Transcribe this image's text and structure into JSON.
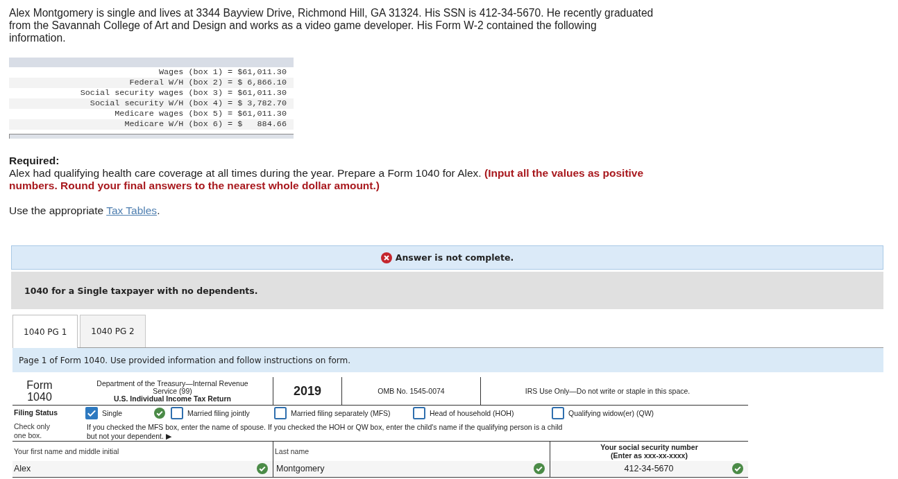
{
  "intro": "Alex Montgomery is single and lives at 3344 Bayview Drive, Richmond Hill, GA 31324. His SSN is 412-34-5670. He recently graduated from the Savannah College of Art and Design and works as a video game developer. His Form W-2 contained the following information.",
  "w2_table": {
    "rows": [
      "Wages (box 1) = $61,011.30",
      "Federal W/H (box 2) = $ 6,866.10",
      "Social security wages (box 3) = $61,011.30",
      "Social security W/H (box 4) = $ 3,782.70",
      "Medicare wages (box 5) = $61,011.30",
      "Medicare W/H (box 6) = $   884.66"
    ]
  },
  "required": {
    "heading": "Required:",
    "text": "Alex had qualifying health care coverage at all times during the year. Prepare a Form 1040 for Alex. **(Input all the values as positive numbers. Round your final answers to the nearest whole dollar amount.)**",
    "use_prefix": "Use the appropriate",
    "link": "Tax Tables",
    "use_suffix": "."
  },
  "answer_status": {
    "text": "Answer is not complete.",
    "complete": false
  },
  "problem_title": "1040 for a Single taxpayer with no dependents.",
  "tabs": [
    {
      "label": "1040 PG 1",
      "selected": true
    },
    {
      "label": "1040 PG 2",
      "selected": false
    }
  ],
  "instruction_bar": "Page 1 of Form 1040. Use provided information and follow instructions on form.",
  "form": {
    "header": {
      "form_label": "Form",
      "form_number": "1040",
      "department": "Department of the Treasury—Internal Revenue Service (99)",
      "form_title": "U.S. Individual Income Tax Return",
      "year": "2019",
      "omb": "OMB No. 1545-0074",
      "irs_note": "IRS Use Only—Do not write or staple in this space."
    },
    "filing_status": {
      "label": "Filing Status",
      "hint": "Check only one box.",
      "options": [
        {
          "label": "Single",
          "checked": true,
          "marked_correct": true
        },
        {
          "label": "Married filing jointly",
          "checked": false,
          "marked_correct": false
        },
        {
          "label": "Married filing separately (MFS)",
          "checked": false,
          "marked_correct": false
        },
        {
          "label": "Head of household (HOH)",
          "checked": false,
          "marked_correct": false
        },
        {
          "label": "Qualifying widow(er) (QW)",
          "checked": false,
          "marked_correct": false
        }
      ],
      "note": "If you checked the MFS box, enter the name of spouse. If you checked the HOH or QW box, enter the child's name if the qualifying person is a child but not your dependent. ▶"
    },
    "name_fields": [
      {
        "label": "Your first name and middle initial",
        "value": "Alex",
        "marked_correct": true
      },
      {
        "label": "Last name",
        "value": "Montgomery",
        "marked_correct": true
      },
      {
        "label": "Your social security number",
        "hint": "(Enter as xxx-xx-xxxx)",
        "value": "412-34-5670",
        "marked_correct": true
      }
    ]
  }
}
